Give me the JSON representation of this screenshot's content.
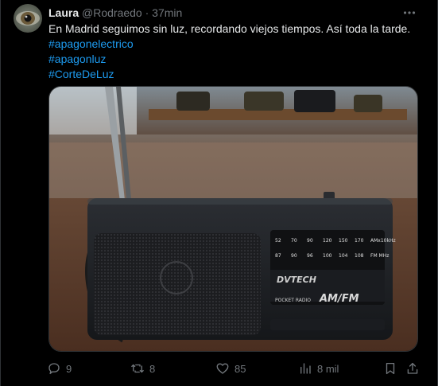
{
  "tweet": {
    "author_name": "Laura",
    "handle": "@Rodraedo",
    "separator": "·",
    "time": "37min",
    "text": "En Madrid seguimos sin luz, recordando viejos tiempos. Así toda la tarde.",
    "hashtags": [
      "#apagonelectrico",
      "#apagonluz",
      "#CorteDeLuz"
    ]
  },
  "media": {
    "radio_brand": "DVTECH",
    "radio_model": "AM/FM",
    "radio_subtitle": "POCKET RADIO",
    "am_scale": [
      "52",
      "70",
      "90",
      "120",
      "150",
      "170",
      "AMx10kHz"
    ],
    "fm_scale": [
      "87",
      "90",
      "96",
      "100",
      "104",
      "108",
      "FM MHz"
    ]
  },
  "actions": {
    "replies": "9",
    "retweets": "8",
    "likes": "85",
    "views": "8 mil"
  },
  "colors": {
    "background": "#000000",
    "text": "#e7e9ea",
    "muted": "#71767b",
    "link": "#1d9bf0",
    "border": "#2f3336"
  }
}
